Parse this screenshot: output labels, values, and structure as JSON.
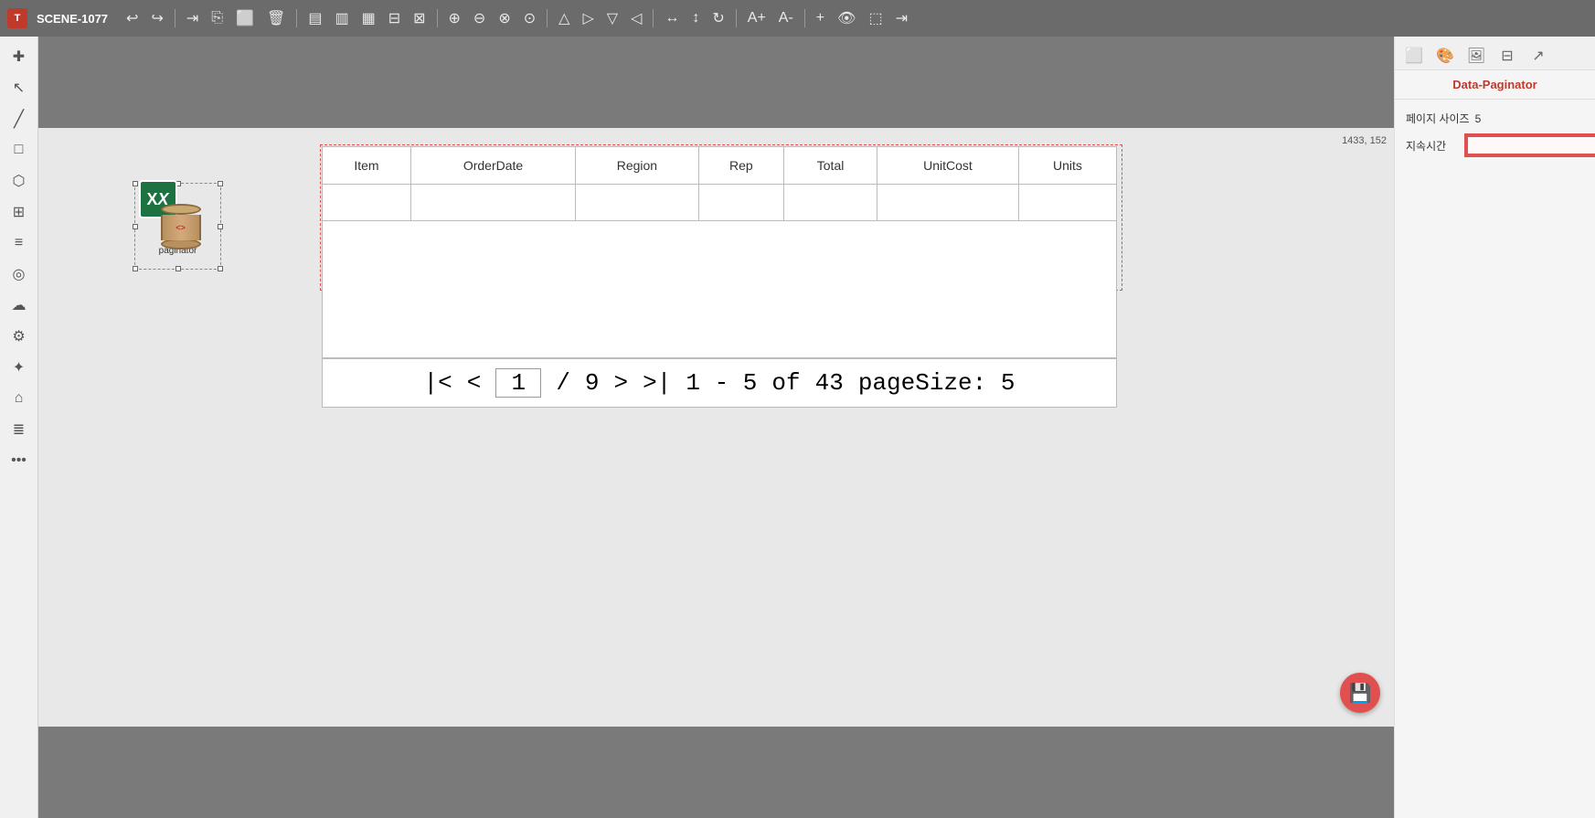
{
  "toolbar": {
    "app_logo": "T",
    "scene_title": "SCENE-1077",
    "buttons": [
      "↩",
      "↪",
      "⇥",
      "⎘",
      "⬜",
      "🗑",
      "▤",
      "▥",
      "⊟",
      "⊞",
      "⊠",
      "⊡",
      "⟦",
      "⟧",
      "⊕",
      "⊖",
      "⊗",
      "⊘",
      "⊙",
      "⊚",
      "△",
      "▷",
      "▽",
      "◁",
      "∿",
      "⊕",
      "⊖",
      "A+",
      "A-",
      "+",
      "👁",
      "⬚",
      "⇥"
    ]
  },
  "left_sidebar": {
    "icons": [
      "+",
      "⊕",
      "−",
      "□",
      "⬡",
      "⊞",
      "≡",
      "◎",
      "☁",
      "⚙",
      "⊕",
      "⌂",
      "≣",
      "•••"
    ]
  },
  "canvas": {
    "coords_display": "1433, 152"
  },
  "paginator_widget": {
    "label": "paginator"
  },
  "data_table": {
    "headers": [
      "Item",
      "OrderDate",
      "Region",
      "Rep",
      "Total",
      "UnitCost",
      "Units"
    ],
    "rows": [
      [
        "",
        "",
        "",
        "",
        "",
        "",
        ""
      ]
    ],
    "empty_rows": 3
  },
  "pagination": {
    "first_label": "|<",
    "prev_label": "<",
    "current_page": "1",
    "separator": "/",
    "total_pages": "9",
    "next_label": ">",
    "last_label": ">|",
    "range_start": "1",
    "range_dash": "-",
    "range_end": "5",
    "of_label": "of",
    "total_records": "43",
    "page_size_label": "pageSize:",
    "page_size_value": "5"
  },
  "right_panel": {
    "title": "Data-Paginator",
    "tabs": [
      "frame-icon",
      "palette-icon",
      "image-icon",
      "sliders-icon",
      "share-icon"
    ],
    "page_size_label": "페이지 사이즈",
    "page_size_value": "5",
    "duration_label": "지속시간",
    "duration_value": "",
    "duration_placeholder": ""
  },
  "save_fab": {
    "icon": "💾",
    "label": "save"
  }
}
